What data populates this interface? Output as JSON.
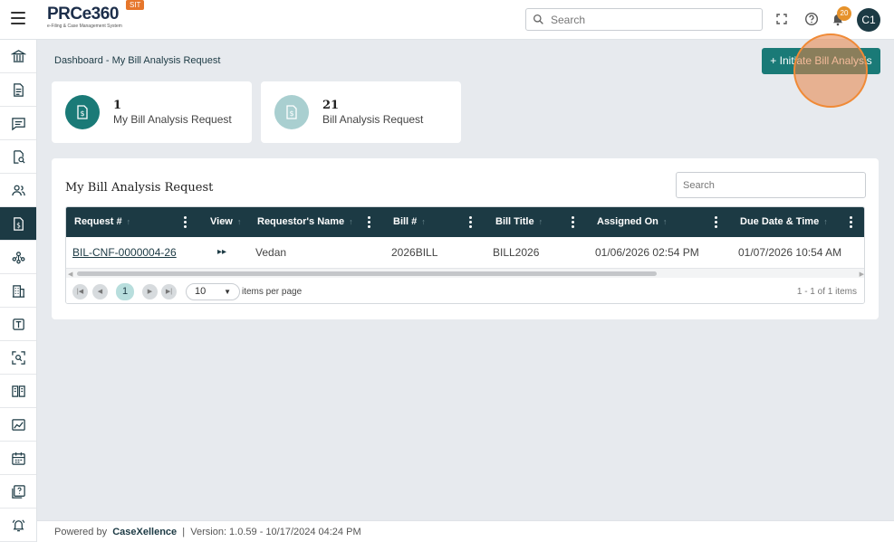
{
  "header": {
    "logo_text": "PRCe360",
    "logo_subtitle": "e-Filing & Case Management System",
    "env_badge": "SIT",
    "search_placeholder": "Search",
    "notification_count": "20",
    "user_initials": "C1",
    "icons": [
      "menu-icon",
      "search-icon",
      "fullscreen-icon",
      "help-icon",
      "bell-icon"
    ]
  },
  "sidebar": {
    "items": [
      {
        "icon": "bank-icon"
      },
      {
        "icon": "document-icon"
      },
      {
        "icon": "chat-icon"
      },
      {
        "icon": "document-search-icon"
      },
      {
        "icon": "users-icon"
      },
      {
        "icon": "bill-icon",
        "active": true
      },
      {
        "icon": "network-users-icon"
      },
      {
        "icon": "building-icon"
      },
      {
        "icon": "text-box-icon"
      },
      {
        "icon": "scan-search-icon"
      },
      {
        "icon": "book-icon"
      },
      {
        "icon": "chart-image-icon"
      },
      {
        "icon": "calendar-icon"
      },
      {
        "icon": "help-document-icon"
      },
      {
        "icon": "alarm-icon"
      }
    ]
  },
  "breadcrumb": "Dashboard - My Bill Analysis Request",
  "initiate_button": "+ Initiate Bill Analysis",
  "cards": [
    {
      "count": "1",
      "label": "My Bill Analysis Request",
      "color": "#1a7a77"
    },
    {
      "count": "21",
      "label": "Bill Analysis Request",
      "color": "#a9cfd0"
    }
  ],
  "panel": {
    "title": "My Bill Analysis Request",
    "search_placeholder": "Search",
    "columns": [
      "Request #",
      "View",
      "Requestor's Name",
      "Bill #",
      "Bill Title",
      "Assigned On",
      "Due Date & Time"
    ],
    "rows": [
      {
        "request": "BIL-CNF-0000004-26",
        "view": "▸▸",
        "requestor": "Vedan",
        "bill_no": "2026BILL",
        "bill_title": "BILL2026",
        "assigned_on": "01/06/2026 02:54 PM",
        "due": "01/07/2026 10:54 AM"
      }
    ],
    "pager": {
      "current_page": "1",
      "page_size": "10",
      "items_per_page_label": "items per page",
      "info": "1 - 1 of 1 items"
    }
  },
  "footer": {
    "powered_by": "Powered by",
    "brand": "CaseXellence",
    "version": "Version: 1.0.59 - 10/17/2024 04:24 PM"
  },
  "colors": {
    "primary": "#1c3a44",
    "accent": "#1a7a77",
    "badge": "#e6762b"
  }
}
